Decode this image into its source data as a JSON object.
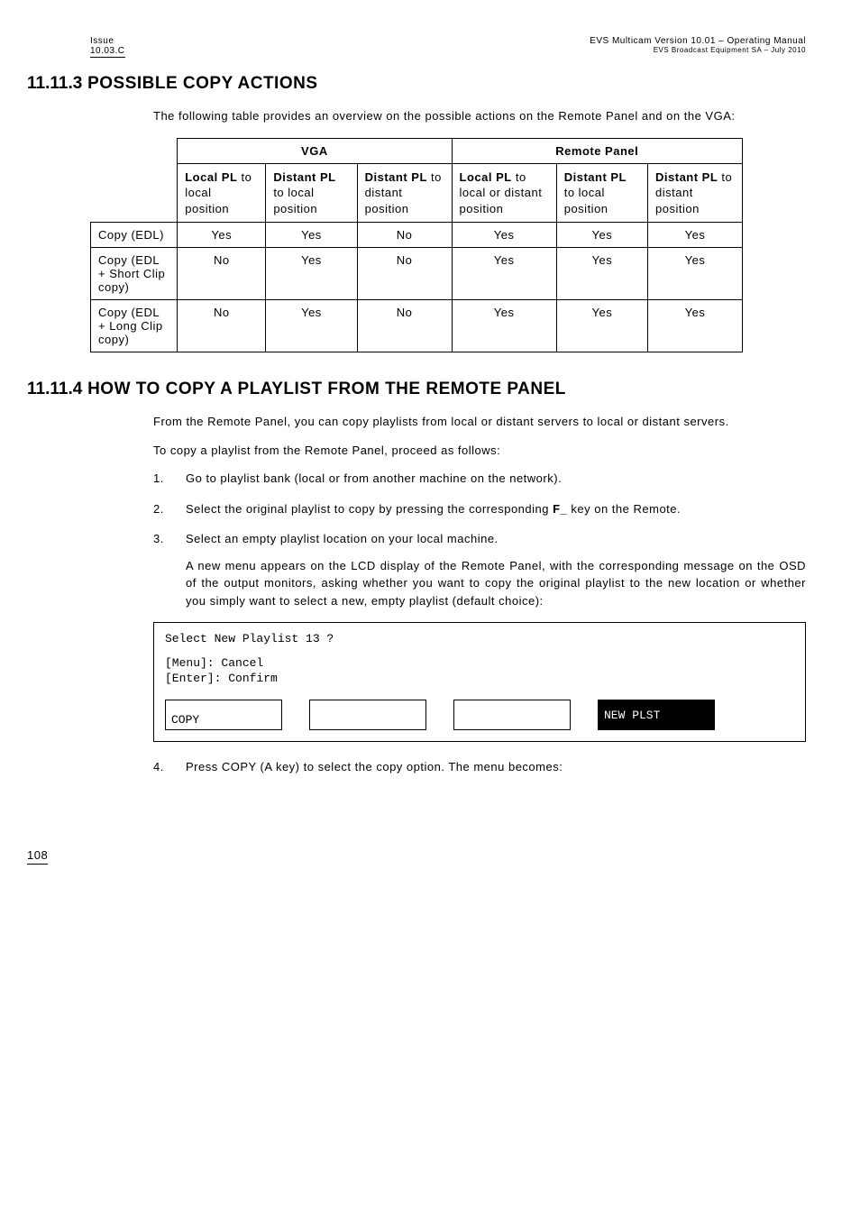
{
  "header": {
    "left_line1": "Issue",
    "left_line2": "10.03.C",
    "right_line1": "EVS Multicam Version 10.01 – Operating Manual",
    "right_line2": "EVS Broadcast Equipment SA – July 2010"
  },
  "section1": {
    "number": "11.11.3",
    "title": "POSSIBLE COPY ACTIONS",
    "intro": "The following table provides an overview on the possible actions on the Remote Panel and on the VGA:"
  },
  "table": {
    "group1": "VGA",
    "group2": "Remote Panel",
    "cols": [
      {
        "bold": "Local PL",
        "rest": " to local position"
      },
      {
        "bold": "Distant PL",
        "rest": " to local position"
      },
      {
        "bold": "Distant PL",
        "rest": " to distant position"
      },
      {
        "bold": "Local PL",
        "rest": " to local or distant position"
      },
      {
        "bold": "Distant PL",
        "rest": " to local position"
      },
      {
        "bold": "Distant PL",
        "rest": " to distant position"
      }
    ],
    "rows": [
      {
        "label": "Copy (EDL)",
        "v": [
          "Yes",
          "Yes",
          "No",
          "Yes",
          "Yes",
          "Yes"
        ]
      },
      {
        "label": "Copy (EDL + Short Clip copy)",
        "v": [
          "No",
          "Yes",
          "No",
          "Yes",
          "Yes",
          "Yes"
        ]
      },
      {
        "label": "Copy (EDL + Long Clip copy)",
        "v": [
          "No",
          "Yes",
          "No",
          "Yes",
          "Yes",
          "Yes"
        ]
      }
    ]
  },
  "section2": {
    "number": "11.11.4",
    "title": "HOW TO COPY A PLAYLIST FROM THE REMOTE PANEL",
    "p1": "From the Remote Panel, you can copy playlists from local or distant servers to local or distant servers.",
    "p2": "To copy a playlist from the Remote Panel, proceed as follows:",
    "steps": {
      "s1": "Go to playlist bank (local or from another machine on the network).",
      "s2a": "Select the original playlist to copy by pressing the corresponding ",
      "s2b": "F_",
      "s2c": " key on the Remote.",
      "s3": "Select an empty playlist location on your local machine.",
      "s3_sub": "A new menu appears on the LCD display of the Remote Panel, with the corresponding message on the OSD of the output monitors, asking whether you want to copy the original playlist to the new location or whether you simply want to select a new, empty playlist (default choice):",
      "s4": "Press COPY (A key) to select the copy option. The menu becomes:"
    }
  },
  "lcd": {
    "line1": "Select New Playlist 13 ?",
    "line2": "[Menu]: Cancel",
    "line3": "[Enter]: Confirm",
    "btn_copy": "COPY",
    "btn_new": "NEW PLST"
  },
  "footer": {
    "page": "108"
  }
}
